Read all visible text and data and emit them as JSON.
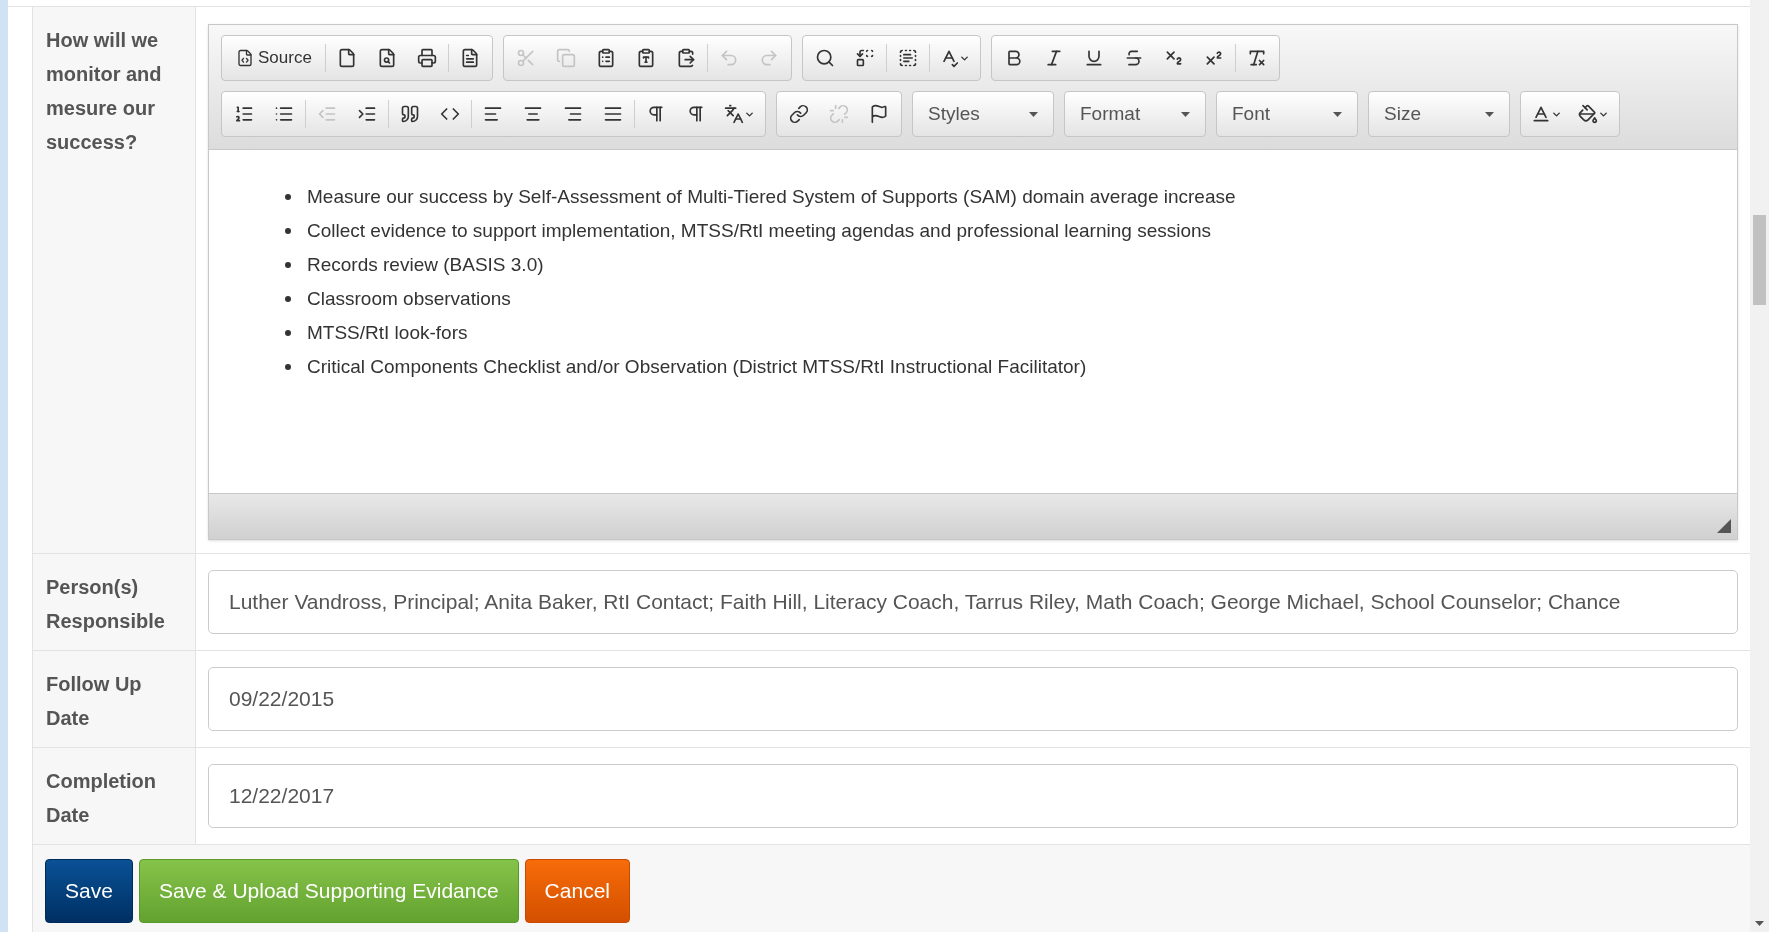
{
  "fields": [
    {
      "kind": "editor",
      "label": "How will we monitor and mesure our success?",
      "toolbar_rows": [
        [
          {
            "kind": "group",
            "sections": [
              [
                {
                  "kind": "text",
                  "label": "Source",
                  "disabled": false
                }
              ],
              [
                {
                  "kind": "icon",
                  "disabled": false
                },
                {
                  "kind": "icon",
                  "disabled": false
                },
                {
                  "kind": "icon",
                  "disabled": false
                }
              ],
              [
                {
                  "kind": "icon",
                  "disabled": false
                }
              ]
            ]
          },
          {
            "kind": "group",
            "sections": [
              [
                {
                  "kind": "icon",
                  "disabled": true
                },
                {
                  "kind": "icon",
                  "disabled": true
                },
                {
                  "kind": "icon",
                  "disabled": false
                },
                {
                  "kind": "icon",
                  "disabled": false
                },
                {
                  "kind": "icon",
                  "disabled": false
                }
              ],
              [
                {
                  "kind": "icon",
                  "disabled": true
                },
                {
                  "kind": "icon",
                  "disabled": true
                }
              ]
            ]
          },
          {
            "kind": "group",
            "sections": [
              [
                {
                  "kind": "icon",
                  "disabled": false
                },
                {
                  "kind": "icon",
                  "disabled": false
                }
              ],
              [
                {
                  "kind": "icon",
                  "disabled": false
                }
              ],
              [
                {
                  "kind": "menu",
                  "disabled": false
                }
              ]
            ]
          },
          {
            "kind": "group",
            "sections": [
              [
                {
                  "kind": "icon",
                  "disabled": false
                },
                {
                  "kind": "icon",
                  "disabled": false
                },
                {
                  "kind": "icon",
                  "disabled": false
                },
                {
                  "kind": "icon",
                  "disabled": false
                },
                {
                  "kind": "icon",
                  "disabled": false
                },
                {
                  "kind": "icon",
                  "disabled": false
                }
              ],
              [
                {
                  "kind": "icon",
                  "disabled": false
                }
              ]
            ]
          }
        ],
        [
          {
            "kind": "group",
            "sections": [
              [
                {
                  "kind": "icon",
                  "disabled": false
                },
                {
                  "kind": "icon",
                  "disabled": false
                }
              ],
              [
                {
                  "kind": "icon",
                  "disabled": true
                },
                {
                  "kind": "icon",
                  "disabled": false
                }
              ],
              [
                {
                  "kind": "icon",
                  "disabled": false
                },
                {
                  "kind": "icon",
                  "disabled": false
                }
              ],
              [
                {
                  "kind": "icon",
                  "disabled": false
                },
                {
                  "kind": "icon",
                  "disabled": false
                },
                {
                  "kind": "icon",
                  "disabled": false
                },
                {
                  "kind": "icon",
                  "disabled": false
                }
              ],
              [
                {
                  "kind": "icon",
                  "disabled": false
                },
                {
                  "kind": "icon",
                  "disabled": false
                },
                {
                  "kind": "menu",
                  "disabled": false
                }
              ]
            ]
          },
          {
            "kind": "group",
            "sections": [
              [
                {
                  "kind": "icon",
                  "disabled": false
                },
                {
                  "kind": "icon",
                  "disabled": true
                },
                {
                  "kind": "icon",
                  "disabled": false
                }
              ]
            ]
          },
          {
            "kind": "combo",
            "label": "Styles"
          },
          {
            "kind": "combo",
            "label": "Format"
          },
          {
            "kind": "combo",
            "label": "Font"
          },
          {
            "kind": "combo",
            "label": "Size"
          },
          {
            "kind": "group",
            "sections": [
              [
                {
                  "kind": "menu",
                  "disabled": false
                },
                {
                  "kind": "menu",
                  "disabled": false
                }
              ]
            ]
          }
        ]
      ],
      "bullets": [
        "Measure our success by Self-Assessment of Multi-Tiered System of Supports (SAM) domain average increase",
        "Collect evidence to support implementation, MTSS/RtI meeting agendas and professional learning sessions",
        "Records review (BASIS 3.0)",
        "Classroom observations",
        "MTSS/RtI look-fors",
        "Critical Components Checklist and/or Observation (District MTSS/RtI Instructional Facilitator)"
      ]
    },
    {
      "kind": "input",
      "label": "Person(s) Responsible",
      "value": "Luther Vandross, Principal; Anita Baker, RtI Contact; Faith Hill, Literacy Coach, Tarrus Riley, Math Coach; George Michael, School Counselor; Chance"
    },
    {
      "kind": "input",
      "label": "Follow Up Date",
      "value": "09/22/2015"
    },
    {
      "kind": "input",
      "label": "Completion Date",
      "value": "12/22/2017"
    }
  ],
  "buttons": [
    {
      "label": "Save",
      "kind": "primary"
    },
    {
      "label": "Save & Upload Supporting Evidance",
      "kind": "success"
    },
    {
      "label": "Cancel",
      "kind": "danger"
    }
  ]
}
